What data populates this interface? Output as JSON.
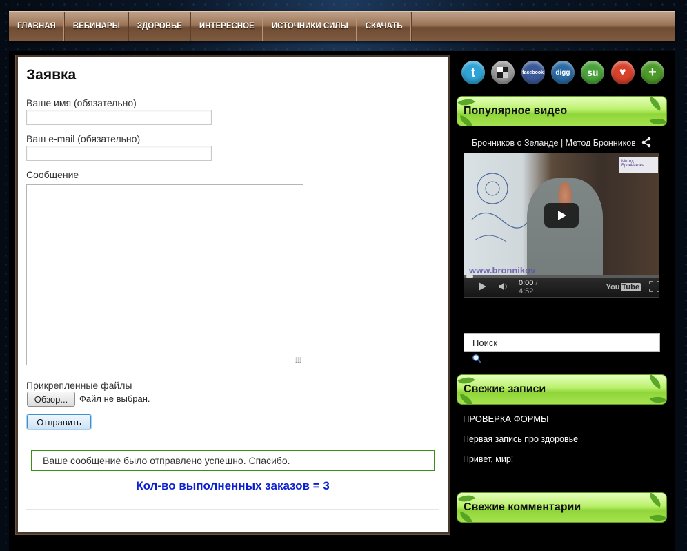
{
  "nav": {
    "items": [
      "ГЛАВНАЯ",
      "ВЕБИНАРЫ",
      "ЗДОРОВЬЕ",
      "ИНТЕРЕСНОЕ",
      "ИСТОЧНИКИ СИЛЫ",
      "СКАЧАТЬ"
    ]
  },
  "form": {
    "title": "Заявка",
    "name_label": "Ваше имя (обязательно)",
    "name_value": "",
    "email_label": "Ваш e-mail (обязательно)",
    "email_value": "",
    "message_label": "Сообщение",
    "message_value": "",
    "attachments_label": "Прикрепленные файлы",
    "browse_label": "Обзор...",
    "file_status": "Файл не выбран.",
    "submit_label": "Отправить",
    "success_message": "Ваше сообщение было отправлено успешно. Спасибо.",
    "orders_count_text": "Кол-во выполненных заказов = 3"
  },
  "sidebar": {
    "social_icons": [
      {
        "name": "twitter-icon",
        "color": "#2fa3d6",
        "glyph": "t"
      },
      {
        "name": "delicious-icon",
        "color": "#8a8a8a",
        "glyph": ""
      },
      {
        "name": "facebook-icon",
        "color": "#3b5998",
        "glyph": "facebook"
      },
      {
        "name": "digg-icon",
        "color": "#2a6ba3",
        "glyph": "digg"
      },
      {
        "name": "stumbleupon-icon",
        "color": "#4aa33a",
        "glyph": "su"
      },
      {
        "name": "favorite-icon",
        "color": "#d9412b",
        "glyph": "♥"
      },
      {
        "name": "add-more-icon",
        "color": "#4c9a2a",
        "glyph": "+"
      }
    ],
    "popular_video_title": "Популярное видео",
    "video": {
      "title": "Бронников о Зеланде | Метод Бронникова",
      "time_current": "0:00",
      "time_total": "4:52",
      "youtube_label": "You Tube",
      "watermark": "www.bronnikov"
    },
    "search_placeholder": "Поиск",
    "recent_posts_title": "Свежие записи",
    "recent_posts": [
      "ПРОВЕРКА ФОРМЫ",
      "Первая запись про здоровье",
      "Привет, мир!"
    ],
    "recent_comments_title": "Свежие комментарии"
  }
}
